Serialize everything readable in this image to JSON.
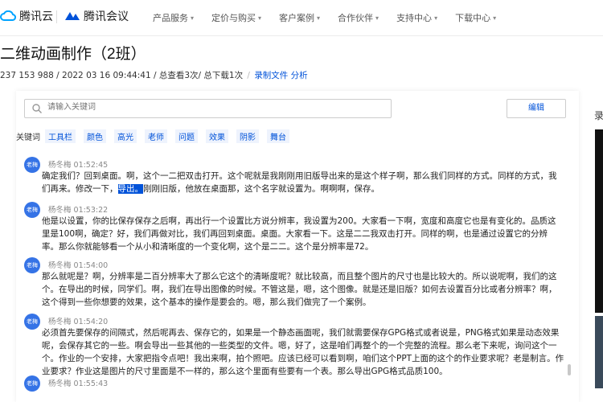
{
  "brand": {
    "tencent_cloud": "腾讯云",
    "tencent_meeting": "腾讯会议"
  },
  "nav": {
    "items": [
      "产品服务",
      "定价与购买",
      "客户案例",
      "合作伙伴",
      "支持中心",
      "下载中心"
    ]
  },
  "title": "二维动画制作（2班）",
  "meta": {
    "info": "237 153 988 / 2022 03 16 09:44:41 / 总查看3次/ 总下载1次",
    "record_link": "录制文件",
    "analysis_link": "分析"
  },
  "search": {
    "placeholder": "请输入关键词"
  },
  "edit_button": "编辑",
  "keywords": {
    "label": "关键词",
    "items": [
      "工具栏",
      "颜色",
      "高光",
      "老师",
      "问题",
      "效果",
      "阴影",
      "舞台"
    ]
  },
  "messages": [
    {
      "avatar": "老梅",
      "speaker": "杨冬梅 01:52:45",
      "pre": "确定我们？回到桌面。啊，这个一二把双击打开。这个呢就是我刚刚用旧版导出来的是这个样子啊，那么我们同样的方式。同样的方式，我们再来。修改一下，",
      "hl": "导出。",
      "post": "刚刚旧版，他放在桌面那，这个名字就设置为。啊啊啊，保存。"
    },
    {
      "avatar": "老梅",
      "speaker": "杨冬梅 01:53:22",
      "text": "他是以设置，你的比保存保存之后啊，再出行一个设置比方说分辨率，我设置为200。大家看一下啊，宽度和高度它也是有变化的。品质这里是100啊，确定？好，我们再做对比，我们再回到桌面。桌面。大家看一下。这是二二我双击打开。同样的啊，也是通过设置它的分辨率。那么你就能够看一个从小和清晰度的一个变化啊，这个是二二。这个是分辨率是72。"
    },
    {
      "avatar": "老梅",
      "speaker": "杨冬梅 01:54:00",
      "text": "那么就呢是？啊，分辨率是二百分辨率大了那么它这个的清晰度呢？就比较高，而且整个图片的尺寸也是比较大的。所以说呢啊，我们的这个。在导出的时候，同学们。啊，我们在导出图像的时候。不管这是，嗯，这个图像。就是还是旧版？如何去设置百分比或者分辨率？啊，这个得到一些你想要的效果，这个基本的操作是要会的。嗯，那么我们做完了一个案例。"
    },
    {
      "avatar": "老梅",
      "speaker": "杨冬梅 01:54:20",
      "text": "必须首先要保存的间隔式，然后呢再去、保存它的，如果是一个静态画面呢，我们就需要保存GPG格式或者说是，PNG格式如果是动态效果呢，会保存其它的一些。啊会导出一些其他的一些类型的文件。嗯，好了，这是咱们再整个的一个完整的流程。那么老下来呢，询问这个一个。作业的一个安排，大家把指令点吧！我出来啊，拍个照吧。应该已经可以看到啊，咱们这个PPT上面的这个的作业要求呢？老是制言。作业要求？作业这是图片的尺寸里面是不一样的，那么这个里面有些要有一个表。那么导出GPG格式品质100。"
    },
    {
      "avatar": "老梅",
      "speaker": "杨冬梅 01:55:43",
      "text": ""
    }
  ],
  "right_panel": {
    "title_fragment": "录"
  },
  "colors": {
    "accent": "#0052d9",
    "avatar": "#3573e6",
    "highlight": "#0052d9"
  }
}
